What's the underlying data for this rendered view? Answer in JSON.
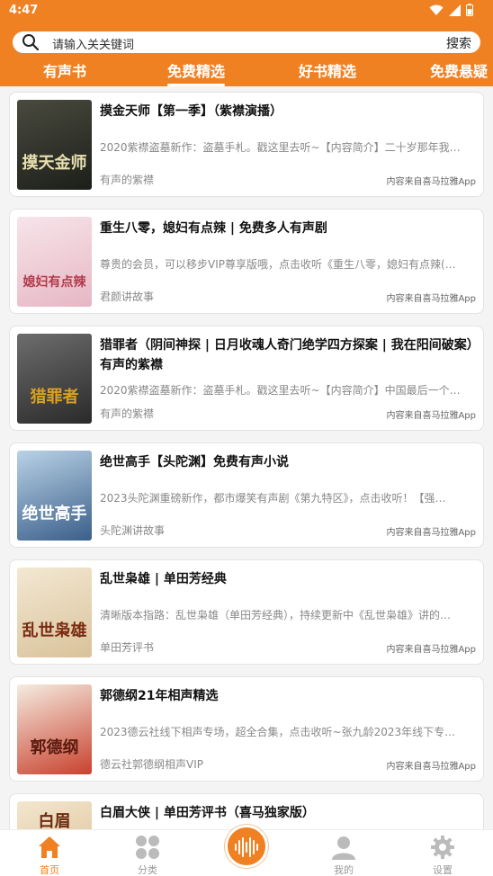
{
  "status_bar": {
    "time": "4:47"
  },
  "search": {
    "placeholder": "请输入关关键词",
    "button_label": "搜索"
  },
  "tabs": [
    {
      "label": "有声书",
      "active": false
    },
    {
      "label": "免费精选",
      "active": true
    },
    {
      "label": "好书精选",
      "active": false
    },
    {
      "label": "免费悬疑",
      "active": false
    }
  ],
  "items": [
    {
      "title": "摸金天师【第一季】（紫襟演播）",
      "desc": "2020紫襟盗墓新作：盗墓手札。戳这里去听~【内容简介】二十岁那年我…",
      "author": "有声的紫襟",
      "source": "内容来自喜马拉雅App",
      "cover_text": "摸天金师"
    },
    {
      "title": "重生八零，媳妇有点辣 | 免费多人有声剧",
      "desc": "尊贵的会员，可以移步VIP尊享版哦，点击收听《重生八零，媳妇有点辣(…",
      "author": "君颜讲故事",
      "source": "内容来自喜马拉雅App",
      "cover_text": "媳妇有点辣"
    },
    {
      "title": "猎罪者（阴间神探 | 日月收魂人奇门绝学四方探案 | 我在阳间破案）有声的紫襟",
      "desc": "2020紫襟盗墓新作：盗墓手札。戳这里去听~【内容简介】中国最后一个…",
      "author": "有声的紫襟",
      "source": "内容来自喜马拉雅App",
      "cover_text": "猎罪者"
    },
    {
      "title": "绝世高手【头陀渊】免费有声小说",
      "desc": "2023头陀渊重磅新作，都市爆笑有声剧《第九特区》，点击收听！【强…",
      "author": "头陀渊讲故事",
      "source": "内容来自喜马拉雅App",
      "cover_text": "绝世高手"
    },
    {
      "title": "乱世枭雄 | 单田芳经典",
      "desc": "清晰版本指路：乱世枭雄（单田芳经典），持续更新中《乱世枭雄》讲的…",
      "author": "单田芳评书",
      "source": "内容来自喜马拉雅App",
      "cover_text": "乱世枭雄"
    },
    {
      "title": "郭德纲21年相声精选",
      "desc": "2023德云社线下相声专场，超全合集，点击收听~张九龄2023年线下专…",
      "author": "德云社郭德纲相声VIP",
      "source": "内容来自喜马拉雅App",
      "cover_text": "郭德纲"
    },
    {
      "title": "白眉大侠 | 单田芳评书（喜马独家版）",
      "desc": "",
      "author": "",
      "source": "",
      "cover_text": "白眉"
    }
  ],
  "bottom_nav": [
    {
      "label": "首页",
      "icon": "home-icon",
      "active": true
    },
    {
      "label": "分类",
      "icon": "category-icon",
      "active": false
    },
    {
      "label": "",
      "icon": "audio-wave-icon",
      "active": false
    },
    {
      "label": "我的",
      "icon": "user-icon",
      "active": false
    },
    {
      "label": "设置",
      "icon": "gear-icon",
      "active": false
    }
  ],
  "colors": {
    "accent": "#f08122",
    "text_muted": "#888888"
  }
}
